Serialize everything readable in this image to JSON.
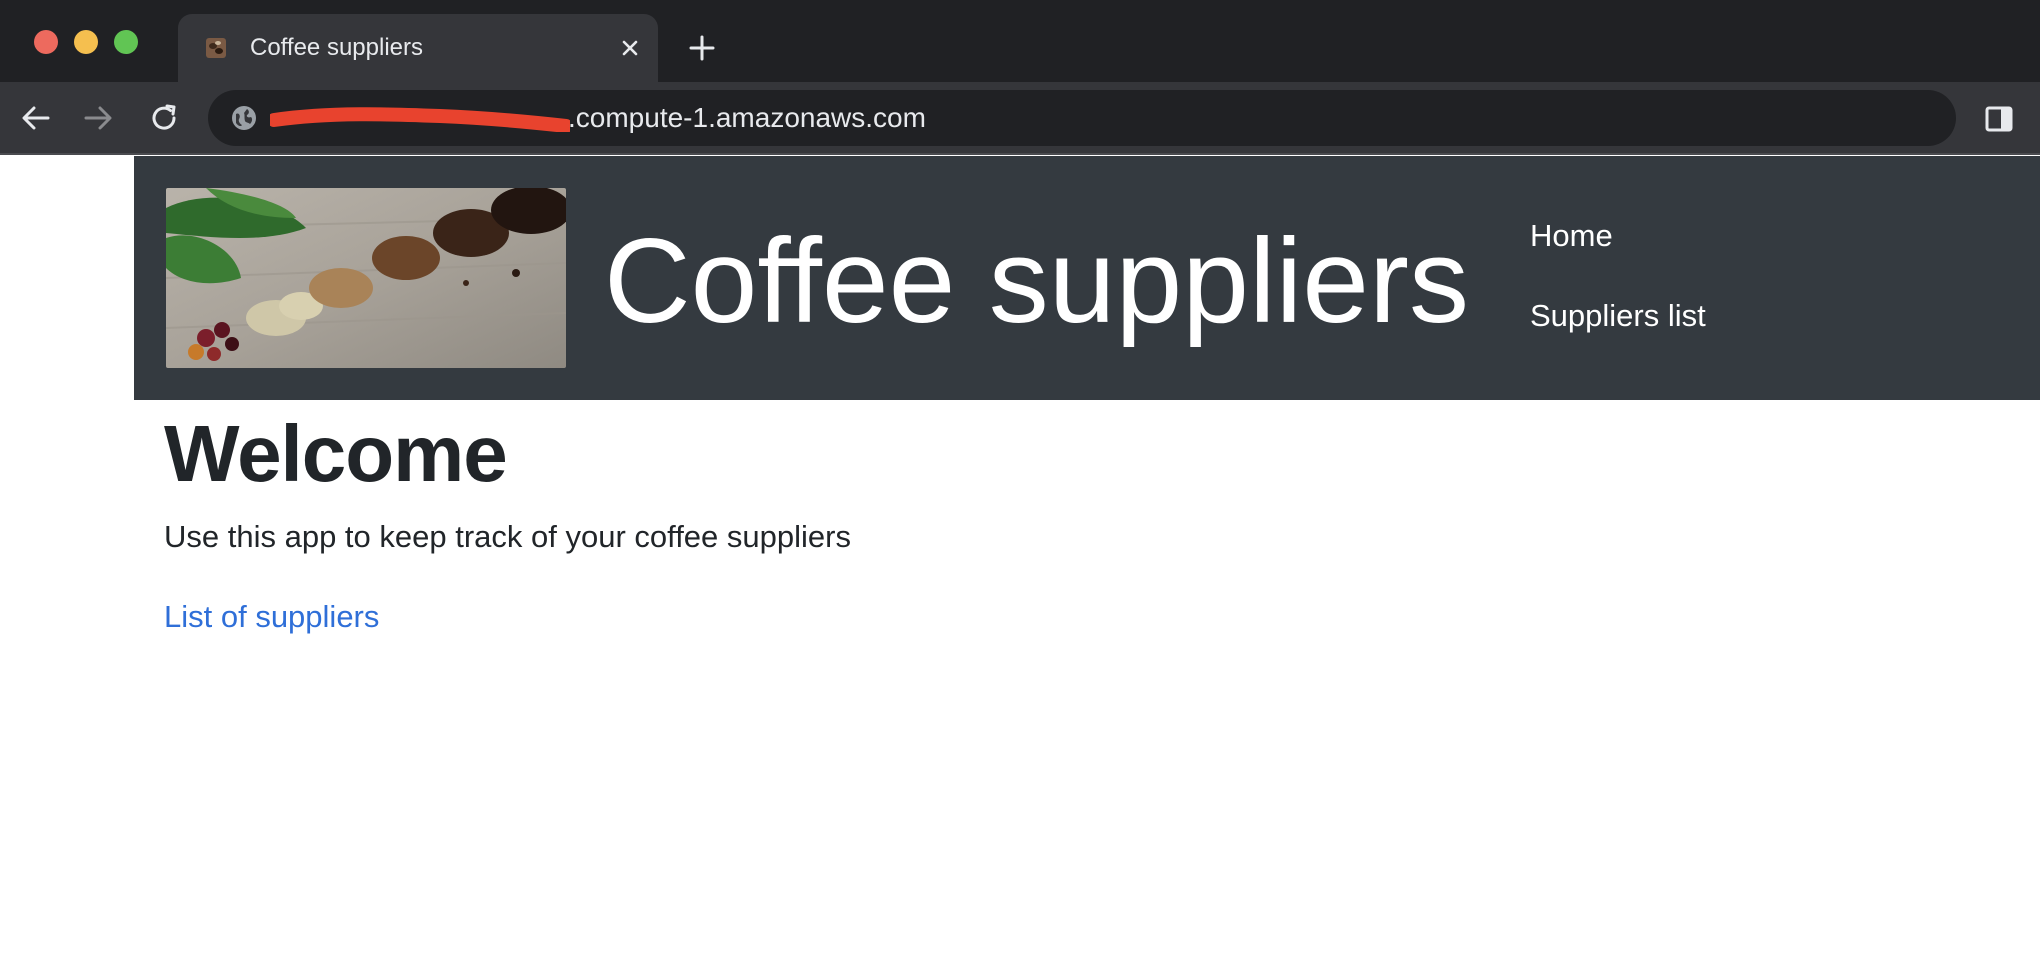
{
  "browser": {
    "tab_title": "Coffee suppliers",
    "url_host": ".compute-1.amazonaws.com"
  },
  "header": {
    "site_title": "Coffee suppliers",
    "nav": [
      {
        "label": "Home"
      },
      {
        "label": "Suppliers list"
      }
    ]
  },
  "main": {
    "heading": "Welcome",
    "intro": "Use this app to keep track of your coffee suppliers",
    "link_label": "List of suppliers"
  },
  "colors": {
    "header_bg": "#343a40",
    "link": "#2f6fd8",
    "redaction": "#e8432e"
  },
  "icons": [
    "coffee-favicon-icon",
    "close-icon",
    "plus-icon",
    "back-arrow-icon",
    "forward-arrow-icon",
    "reload-icon",
    "globe-icon",
    "side-panel-icon"
  ]
}
